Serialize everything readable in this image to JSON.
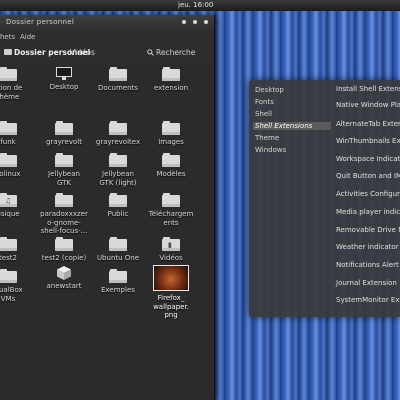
{
  "topbar": {
    "clock": "jeu. 16:00"
  },
  "nautilus": {
    "title": "Dossier personnel",
    "menu": [
      "hets",
      "Aide"
    ],
    "location": {
      "current": "Dossier personnel",
      "next": "Vidéos"
    },
    "search_label": "Recherche",
    "items": [
      {
        "label": "ation de\nthème",
        "icon": "folder-icon"
      },
      {
        "label": "Desktop",
        "icon": "monitor-icon"
      },
      {
        "label": "Documents",
        "icon": "folder-icon"
      },
      {
        "label": "extension",
        "icon": "folder-icon"
      },
      {
        "label": "funk",
        "icon": "folder-icon"
      },
      {
        "label": "grayrevolt",
        "icon": "folder-icon"
      },
      {
        "label": "grayrevoltex",
        "icon": "folder-icon"
      },
      {
        "label": "Images",
        "icon": "folder-icon"
      },
      {
        "label": "solinux",
        "icon": "folder-icon"
      },
      {
        "label": "Jellybean\nGTK",
        "icon": "folder-icon"
      },
      {
        "label": "Jellybean\nGTK (light)",
        "icon": "folder-icon"
      },
      {
        "label": "Modèles",
        "icon": "folder-icon"
      },
      {
        "label": "usique",
        "icon": "music-folder-icon"
      },
      {
        "label": "paradoxxxzer\no-gnome-\nshell-focus-...",
        "icon": "folder-icon"
      },
      {
        "label": "Public",
        "icon": "folder-icon"
      },
      {
        "label": "Téléchargem\nents",
        "icon": "folder-icon"
      },
      {
        "label": "test2",
        "icon": "folder-icon"
      },
      {
        "label": "test2 (copie)",
        "icon": "folder-icon"
      },
      {
        "label": "Ubuntu One",
        "icon": "folder-icon"
      },
      {
        "label": "Vidéos",
        "icon": "video-folder-icon"
      },
      {
        "label": "rtualBox\nVMs",
        "icon": "folder-icon"
      },
      {
        "label": "anewstart",
        "icon": "cube-icon"
      },
      {
        "label": "Exemples",
        "icon": "folder-icon"
      },
      {
        "label": "Firefox_\nwallpaper.\npng",
        "icon": "image-thumbnail-icon"
      }
    ]
  },
  "settings": {
    "categories": [
      "Desktop",
      "Fonts",
      "Shell",
      "Shell Extensions",
      "Theme",
      "Windows"
    ],
    "active_category": "Shell Extensions",
    "extensions": [
      "Install Shell Extension",
      "Native Window Pla",
      "AlternateTab Exter",
      "WinThumbnails Ext",
      "Workspace Indicato",
      "Quit Button and IM",
      "Activities Configur",
      "Media player indica",
      "Removable Drive M",
      "Weather indicator",
      "Notifications Alert",
      "Journal Extension",
      "SystemMonitor Exte"
    ]
  },
  "colors": {
    "accent": "#3d66bf",
    "panel": "#2d2d2d"
  }
}
